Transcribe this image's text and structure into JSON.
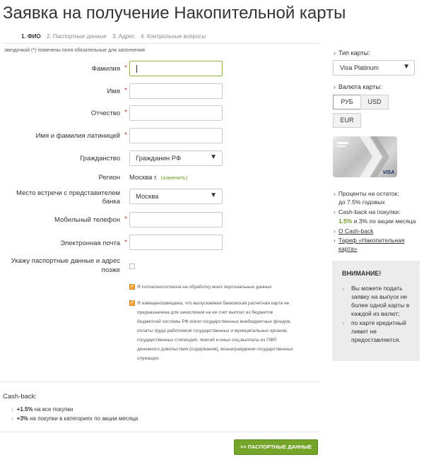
{
  "page": {
    "title": "Заявка на получение Накопительной карты"
  },
  "steps": [
    {
      "label": "1. ФИО",
      "active": true
    },
    {
      "label": "2. Паспортные данные",
      "active": false
    },
    {
      "label": "3. Адрес",
      "active": false
    },
    {
      "label": "4. Контрольные вопросы",
      "active": false
    }
  ],
  "form": {
    "note": "звездочкой (*) помечены поля обязательные для заполнения",
    "required_mark": "*",
    "last_name_label": "Фамилия",
    "first_name_label": "Имя",
    "patronymic_label": "Отчество",
    "latin_name_label": "Имя и фамилия латиницей",
    "citizenship_label": "Гражданство",
    "citizenship_value": "Гражданин РФ",
    "region_label": "Регион",
    "region_value": "Москва г.",
    "region_change": "(изменить)",
    "meeting_label_1": "Место встречи с представителем",
    "meeting_label_2": "банка",
    "meeting_value": "Москва",
    "phone_label": "Мобильный телефон",
    "email_label": "Электронная почта",
    "later_label_1": "Укажу паспортные данные и адрес",
    "later_label_2": "позже",
    "consent_text": "Я согласен/согласна на обработку моих персональных данных",
    "notice_lines": [
      "Я извещен/извещена, что выпускаемая банковская расчетная карта не",
      "предназначена для зачисления на ее счет выплат из бюджетов",
      "бюджетной системы РФ и/или государственных внебюджетных фондов,",
      "оплаты труда работников государственных и муниципальных органов,",
      "государственных стипендий, пенсий и иных соц.выплаты из ПФР,",
      "денежного довольствия (содержания), вознаграждения государственных",
      "служащих."
    ]
  },
  "cashback": {
    "title": "Cash-back:",
    "item1_value": "+1.5%",
    "item1_text": " на все покупки",
    "item2_value": "+3%",
    "item2_text": " на покупки в категориях по акции месяца"
  },
  "next_button": ">> ПАСПОРТНЫЕ ДАННЫЕ",
  "sidebar": {
    "card_type_label": "Тип карты:",
    "card_type_value": "Visa Platinum",
    "currency_label": "Валюта карты:",
    "currencies": [
      "РУБ",
      "USD",
      "EUR"
    ],
    "card_brand": "VISA",
    "interest_label": "Проценты на остаток:",
    "interest_value": "до 7.5% годовых",
    "cashback_label": "Cash-back на покупки:",
    "cashback_value_1": "1.5%",
    "cashback_mid": " и 3% по акции месяца",
    "about_cashback": "О Cash-back",
    "tariff_line1": "Тариф «Накопительная",
    "tariff_line2": "карта»",
    "attention_title": "ВНИМАНИЕ!",
    "attention_item1": [
      "Вы можете подать",
      "заявку на выпуск не",
      "более одной карты в",
      "каждой из валют;"
    ],
    "attention_item2": [
      "по карте кредитный",
      "лимит не",
      "предоставляется."
    ]
  },
  "colors": {
    "accent_green": "#74a52a",
    "link_green": "#6f9a1f",
    "required_red": "#c0392b",
    "checkbox_orange": "#f0a23a"
  }
}
